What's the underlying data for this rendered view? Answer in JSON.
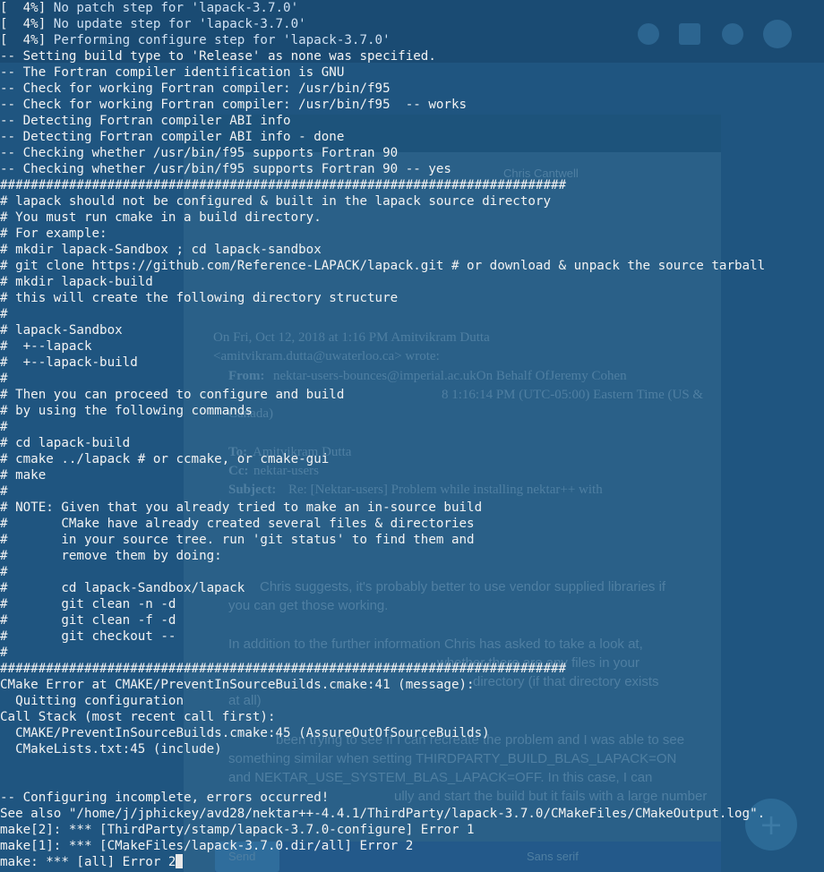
{
  "terminal": {
    "progress_prefix": "[  4%] ",
    "progress_lines": [
      "No patch step for 'lapack-3.7.0'",
      "No update step for 'lapack-3.7.0'",
      "Performing configure step for 'lapack-3.7.0'"
    ],
    "lines": [
      "-- Setting build type to 'Release' as none was specified.",
      "-- The Fortran compiler identification is GNU",
      "-- Check for working Fortran compiler: /usr/bin/f95",
      "-- Check for working Fortran compiler: /usr/bin/f95  -- works",
      "-- Detecting Fortran compiler ABI info",
      "-- Detecting Fortran compiler ABI info - done",
      "-- Checking whether /usr/bin/f95 supports Fortran 90",
      "-- Checking whether /usr/bin/f95 supports Fortran 90 -- yes",
      "##########################################################################",
      "# lapack should not be configured & built in the lapack source directory",
      "# You must run cmake in a build directory.",
      "# For example:",
      "# mkdir lapack-Sandbox ; cd lapack-sandbox",
      "# git clone https://github.com/Reference-LAPACK/lapack.git # or download & unpack the source tarball",
      "# mkdir lapack-build",
      "# this will create the following directory structure",
      "#",
      "# lapack-Sandbox",
      "#  +--lapack",
      "#  +--lapack-build",
      "#",
      "# Then you can proceed to configure and build",
      "# by using the following commands",
      "#",
      "# cd lapack-build",
      "# cmake ../lapack # or ccmake, or cmake-gui",
      "# make",
      "#",
      "# NOTE: Given that you already tried to make an in-source build",
      "#       CMake have already created several files & directories",
      "#       in your source tree. run 'git status' to find them and",
      "#       remove them by doing:",
      "#",
      "#       cd lapack-Sandbox/lapack",
      "#       git clean -n -d",
      "#       git clean -f -d",
      "#       git checkout --",
      "#",
      "##########################################################################",
      "CMake Error at CMAKE/PreventInSourceBuilds.cmake:41 (message):",
      "  Quitting configuration",
      "Call Stack (most recent call first):",
      "  CMAKE/PreventInSourceBuilds.cmake:45 (AssureOutOfSourceBuilds)",
      "  CMakeLists.txt:45 (include)",
      "",
      "",
      "-- Configuring incomplete, errors occurred!",
      "See also \"/home/j/jphickey/avd28/nektar++-4.4.1/ThirdParty/lapack-3.7.0/CMakeFiles/CMakeOutput.log\".",
      "make[2]: *** [ThirdParty/stamp/lapack-3.7.0-configure] Error 1",
      "make[1]: *** [CMakeFiles/lapack-3.7.0.dir/all] Error 2"
    ],
    "last_line": "make: *** [all] Error 2"
  },
  "background_email": {
    "sender": "Chris Cantwell",
    "quote_header": "On Fri, Oct 12, 2018 at 1:16 PM Amitvikram Dutta",
    "quote_email": "<amitvikram.dutta@uwaterloo.ca> wrote:",
    "from_label": "From:",
    "from_value": "nektar-users-bounces@imperial.ac.ukOn Behalf OfJeremy Cohen",
    "sent_value": "8 1:16:14 PM (UTC-05:00) Eastern Time (US &",
    "sent_tail": "Canada)",
    "to_label": "To:",
    "to_value": "Amitvikram Dutta",
    "cc_label": "Cc:",
    "cc_value": "nektar-users",
    "subject_label": "Subject:",
    "subject_value": "Re: [Nektar-users] Problem while installing nektar++ with",
    "para1": "Chris suggests, it's probably better to use vendor supplied libraries if",
    "para1b": "you can get those working.",
    "para2": "In addition to the further information Chris has asked to take a look at,",
    "para2b": "whether there are any files in your",
    "para2c": "directory (if that directory exists",
    "para2d": "at all)",
    "para3": "been trying to see if I can recreate the problem and I was able to see",
    "para3b": "something similar when setting THIRDPARTY_BUILD_BLAS_LAPACK=ON",
    "para3c": "and NEKTAR_USE_SYSTEM_BLAS_LAPACK=OFF. In this case, I can",
    "para3d": "ully and start the build but it fails with a large number",
    "font_select": "Sans serif",
    "send_label": "Send",
    "fab_symbol": "+"
  },
  "colors": {
    "terminal_bg": "#1f5580",
    "terminal_text": "#f3f3f3"
  }
}
